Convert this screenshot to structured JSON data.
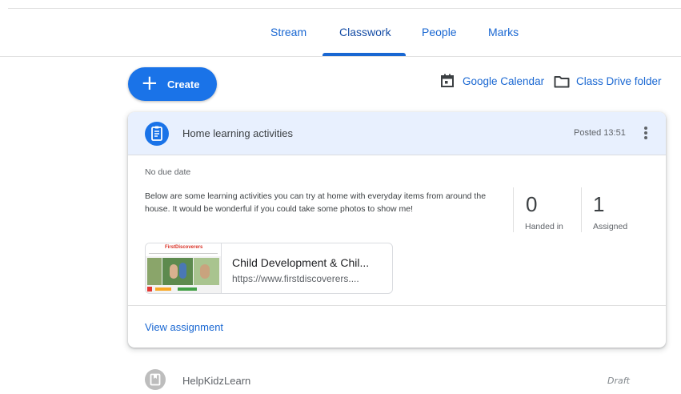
{
  "tabs": [
    {
      "label": "Stream"
    },
    {
      "label": "Classwork"
    },
    {
      "label": "People"
    },
    {
      "label": "Marks"
    }
  ],
  "active_tab": "Classwork",
  "toolbar": {
    "create_label": "Create",
    "calendar_label": "Google Calendar",
    "drive_label": "Class Drive folder"
  },
  "assignment": {
    "title": "Home learning activities",
    "posted": "Posted 13:51",
    "due": "No due date",
    "description": "Below are some learning activities you can try at home with everyday items from around the house. It would be wonderful if you could take some photos to show me!",
    "stats": [
      {
        "value": "0",
        "label": "Handed in"
      },
      {
        "value": "1",
        "label": "Assigned"
      }
    ],
    "attachment": {
      "title": "Child Development & Chil...",
      "url": "https://www.firstdiscoverers....",
      "thumb_brand": "FirstDiscoverers"
    },
    "view_label": "View assignment"
  },
  "next_item": {
    "title": "HelpKidzLearn",
    "status": "Draft"
  },
  "colors": {
    "accent": "#1a73e8",
    "header_bg": "#e8f0fe",
    "link": "#1967d2"
  },
  "icons": [
    "plus-icon",
    "calendar-icon",
    "folder-icon",
    "assignment-icon",
    "more-vert-icon",
    "material-icon"
  ]
}
